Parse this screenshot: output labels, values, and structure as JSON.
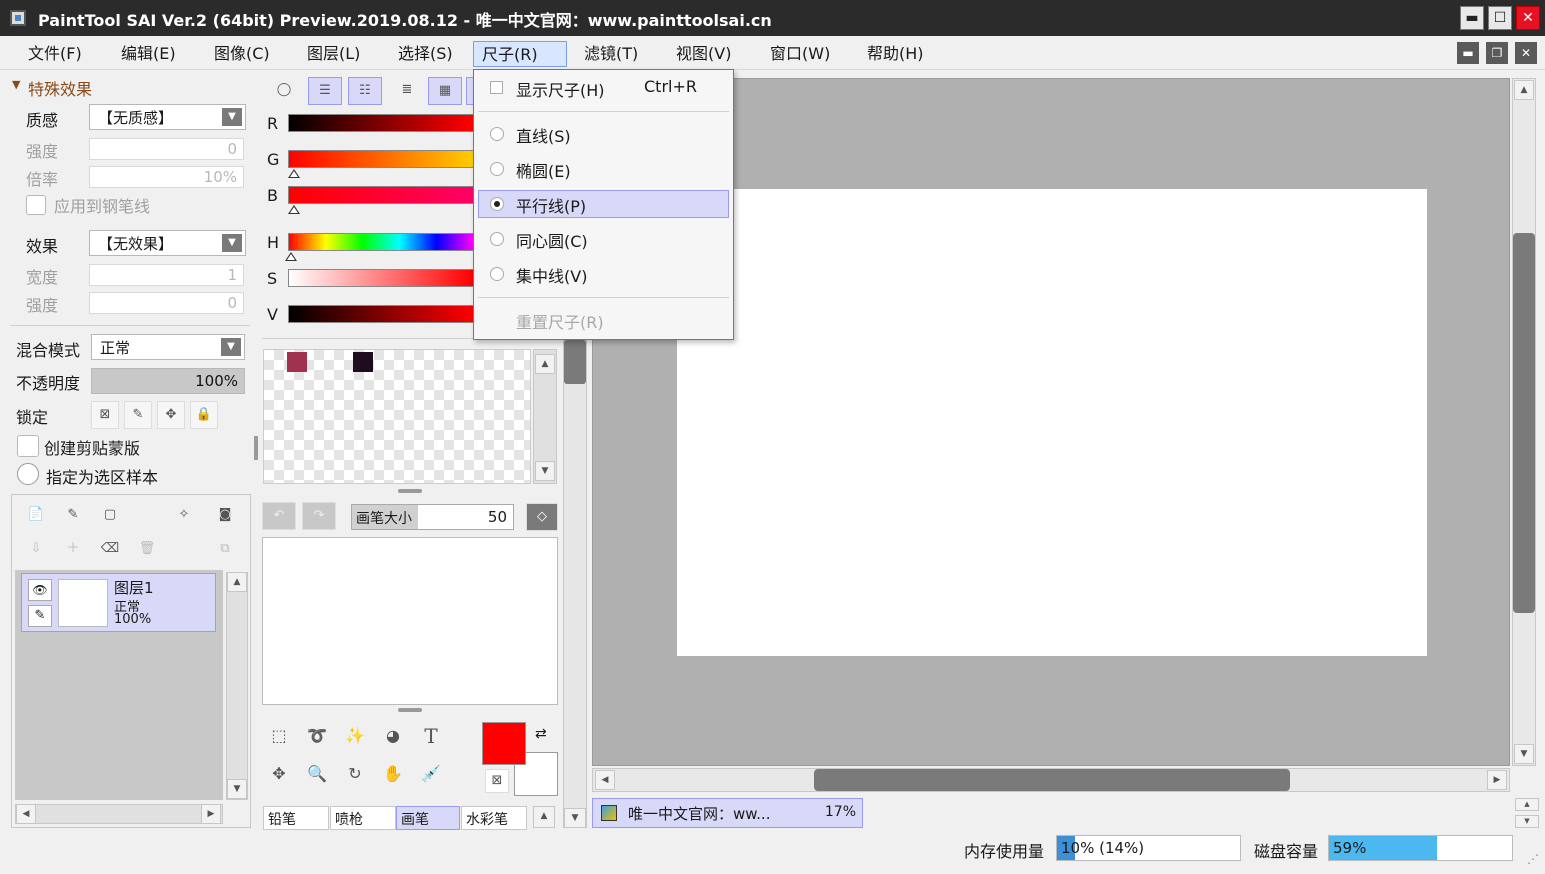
{
  "window": {
    "title": "PaintTool SAI Ver.2 (64bit) Preview.2019.08.12 - 唯一中文官网：www.painttoolsai.cn",
    "minimize": "▬",
    "maximize": "☐",
    "close": "✕"
  },
  "menubar": {
    "items": [
      "文件(F)",
      "编辑(E)",
      "图像(C)",
      "图层(L)",
      "选择(S)",
      "尺子(R)",
      "滤镜(T)",
      "视图(V)",
      "窗口(W)",
      "帮助(H)"
    ],
    "active": "尺子(R)",
    "mdi": [
      "▬",
      "❐",
      "✕"
    ]
  },
  "ruler_menu": {
    "show_ruler": "显示尺子(H)",
    "show_ruler_shortcut": "Ctrl+R",
    "items": [
      "直线(S)",
      "椭圆(E)",
      "平行线(P)",
      "同心圆(C)",
      "集中线(V)"
    ],
    "selected": "平行线(P)",
    "reset": "重置尺子(R)"
  },
  "effects_panel": {
    "header": "特殊效果",
    "texture_label": "质感",
    "texture_value": "【无质感】",
    "strength_label": "强度",
    "strength_value": "0",
    "scale_label": "倍率",
    "scale_value": "10%",
    "apply_pen_label": "应用到钢笔线",
    "effect_label": "效果",
    "effect_value": "【无效果】",
    "width_label": "宽度",
    "width_value": "1",
    "effect_strength_label": "强度",
    "effect_strength_value": "0"
  },
  "layer_props": {
    "blend_label": "混合模式",
    "blend_value": "正常",
    "opacity_label": "不透明度",
    "opacity_value": "100%",
    "opacity": 1.0,
    "lock_label": "锁定",
    "clip_label": "创建剪贴蒙版",
    "sample_label": "指定为选区样本"
  },
  "layers": [
    {
      "name": "图层1",
      "mode": "正常",
      "opacity": "100%"
    }
  ],
  "color_panel": {
    "channels": [
      "R",
      "G",
      "B",
      "H",
      "S",
      "V"
    ],
    "swatches": [
      "#a0324f",
      "#1e0d1e"
    ]
  },
  "brush": {
    "size_label": "画笔大小",
    "size_value": "50"
  },
  "tool_tabs": [
    "铅笔",
    "喷枪",
    "画笔",
    "水彩笔"
  ],
  "tool_tab_selected": "画笔",
  "colors": {
    "primary": "#ff0000",
    "secondary": "#ffffff",
    "accent": "#d8d8f8"
  },
  "canvas_tab": {
    "name": "唯一中文官网：ww...",
    "zoom": "17%"
  },
  "status": {
    "mem_label": "内存使用量",
    "mem_value": "10% (14%)",
    "mem_fraction": 0.1,
    "disk_label": "磁盘容量",
    "disk_value": "59%",
    "disk_fraction": 0.59
  },
  "icons": {
    "expand": "▼",
    "combo_arrow": "▼",
    "scroll_up": "▲",
    "scroll_down": "▼",
    "scroll_left": "◀",
    "scroll_right": "▶",
    "eye": "👁",
    "pencil": "✎",
    "move": "✥",
    "swap": "⇄",
    "text": "T"
  }
}
